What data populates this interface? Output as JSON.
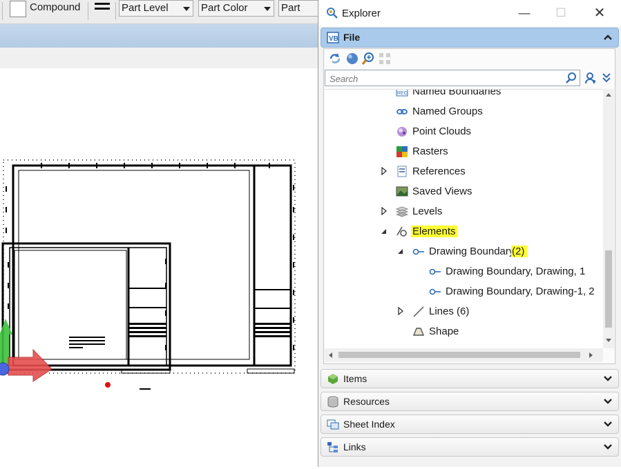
{
  "toolbar": {
    "compound_label": "Compound",
    "level_combo": "Part Level",
    "color_combo": "Part Color",
    "style_combo": "Part Style"
  },
  "explorer": {
    "title": "Explorer",
    "sections": {
      "file": "File",
      "items": "Items",
      "resources": "Resources",
      "sheet_index": "Sheet Index",
      "links": "Links"
    },
    "search": {
      "placeholder": "Search",
      "value": ""
    },
    "tree": {
      "partial_top": "Named Boundaries",
      "named_groups": "Named Groups",
      "point_clouds": "Point Clouds",
      "rasters": "Rasters",
      "references": "References",
      "saved_views": "Saved Views",
      "levels": "Levels",
      "elements": "Elements",
      "drawing_boundary": "Drawing Boundary",
      "drawing_boundary_count": "(2)",
      "drawing_boundary_1": "Drawing Boundary, Drawing, 1",
      "drawing_boundary_2": "Drawing Boundary, Drawing-1, 2",
      "lines": "Lines (6)",
      "shape": "Shape"
    }
  },
  "colors": {
    "file_header": "#a9caea",
    "highlight": "#ffff33",
    "canvas_banner": "#b8cfe7",
    "axis_x": "#e04545",
    "axis_y": "#33b833",
    "origin": "#3355dd"
  },
  "icons": {
    "window": [
      "minimize-icon",
      "maximize-icon",
      "close-icon"
    ],
    "tree": [
      "named-boundaries-icon",
      "named-groups-icon",
      "point-clouds-icon",
      "rasters-icon",
      "references-icon",
      "saved-views-icon",
      "levels-icon",
      "elements-icon",
      "boundary-icon",
      "line-icon",
      "shape-icon"
    ]
  }
}
